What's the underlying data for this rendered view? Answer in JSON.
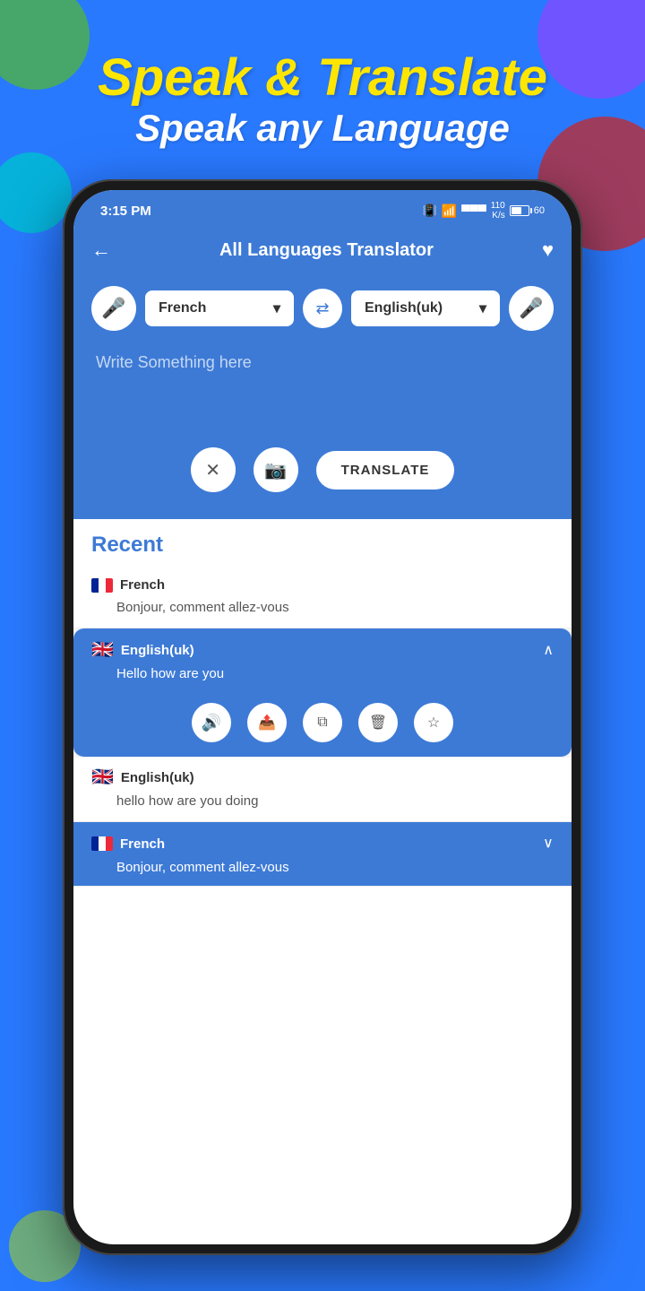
{
  "background": {
    "color": "#2979ff"
  },
  "header": {
    "title": "Speak & Translate",
    "subtitle": "Speak any Language"
  },
  "statusBar": {
    "time": "3:15 PM",
    "battery_level": "60",
    "signal_text": "110\nK/s"
  },
  "appBar": {
    "title": "All Languages Translator",
    "back_label": "←",
    "heart_label": "♥"
  },
  "translator": {
    "source_language": "French",
    "target_language": "English(uk)",
    "input_placeholder": "Write Something here",
    "translate_button": "TRANSLATE"
  },
  "recent": {
    "title": "Recent",
    "items": [
      {
        "language": "French",
        "flag": "fr",
        "text": "Bonjour, comment allez-vous",
        "expanded": false
      },
      {
        "language": "English(uk)",
        "flag": "uk",
        "text": "Hello how are you",
        "expanded": true
      },
      {
        "language": "English(uk)",
        "flag": "uk",
        "text": "hello how are you doing",
        "expanded": false
      },
      {
        "language": "French",
        "flag": "fr",
        "text": "Bonjour, comment allez-vous",
        "expanded": false,
        "collapsed": true
      }
    ],
    "actions": {
      "volume": "🔊",
      "share": "⟨",
      "copy": "⧉",
      "delete": "🗑",
      "star": "☆"
    }
  }
}
